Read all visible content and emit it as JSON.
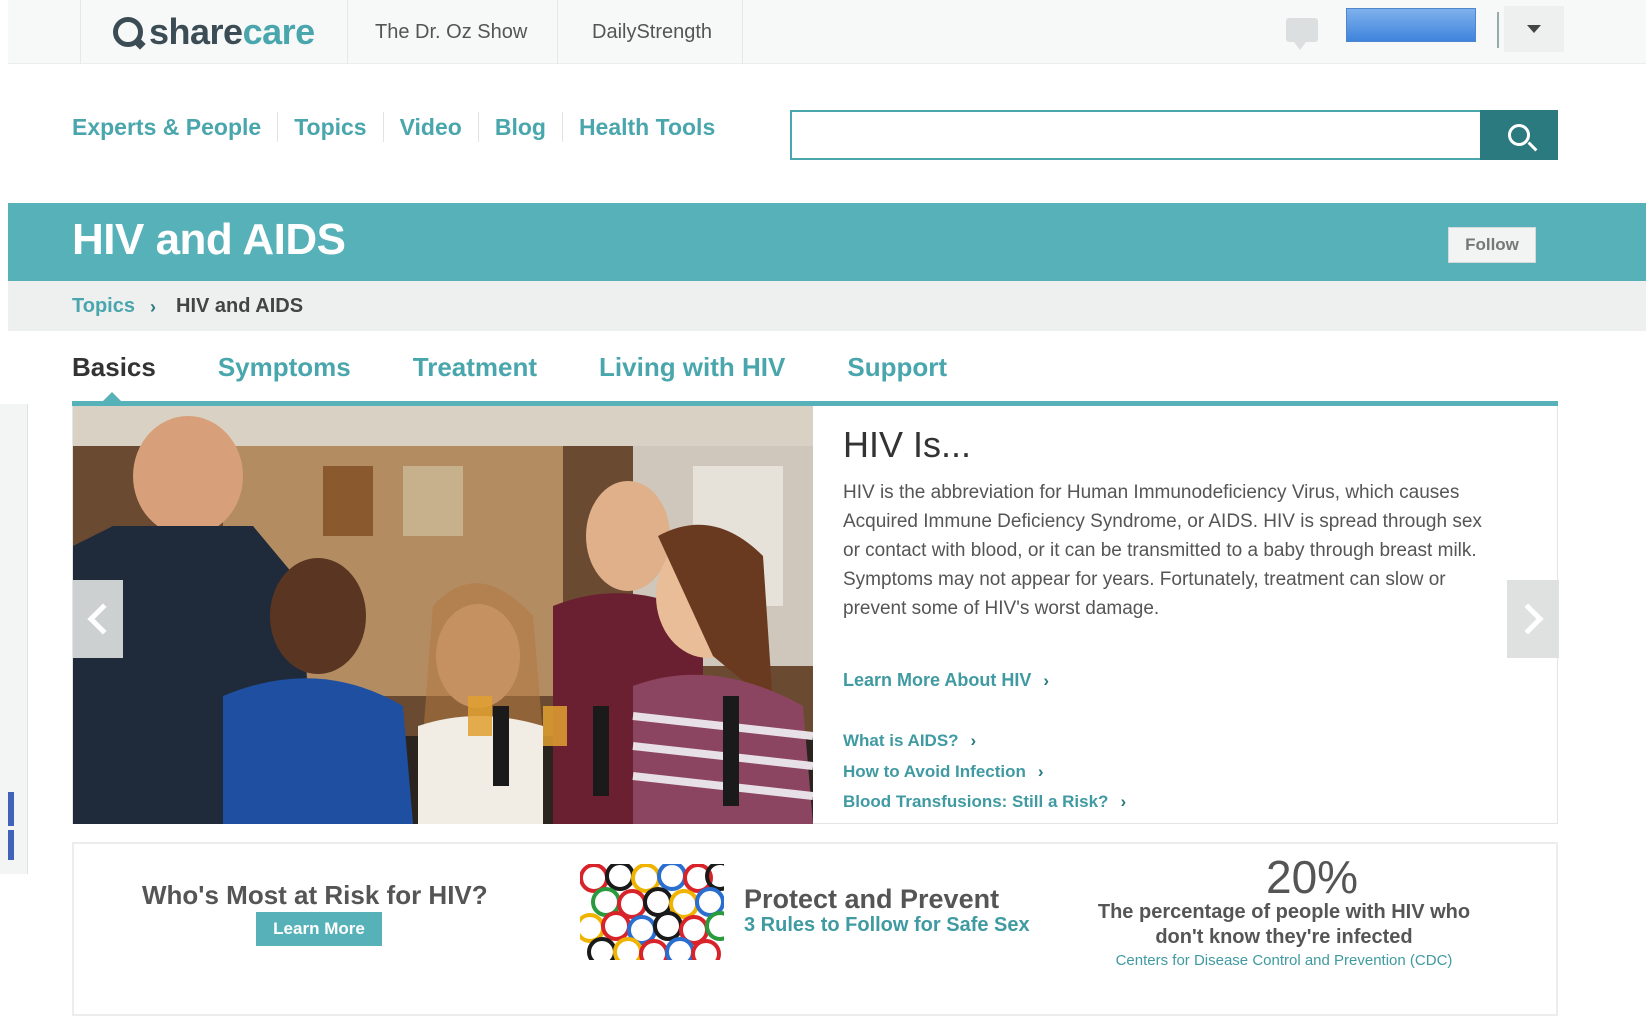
{
  "topbar": {
    "logo_part1": "share",
    "logo_part2": "care",
    "links": [
      "The Dr. Oz Show",
      "DailyStrength"
    ]
  },
  "nav": {
    "items": [
      "Experts & People",
      "Topics",
      "Video",
      "Blog",
      "Health Tools"
    ],
    "search_placeholder": ""
  },
  "banner": {
    "title": "HIV and AIDS",
    "follow_label": "Follow"
  },
  "breadcrumb": {
    "parent": "Topics",
    "separator": "›",
    "current": "HIV and AIDS"
  },
  "tabs": {
    "items": [
      "Basics",
      "Symptoms",
      "Treatment",
      "Living with HIV",
      "Support"
    ],
    "active": "Basics"
  },
  "hero": {
    "title": "HIV Is...",
    "body": "HIV is the abbreviation for Human Immunodeficiency Virus, which causes Acquired Immune Deficiency Syndrome, or AIDS. HIV is spread through sex or contact with blood, or it can be transmitted to a baby through breast milk. Symptoms may not appear for years. Fortunately, treatment can slow or prevent some of HIV's worst damage.",
    "learn_more": "Learn More About HIV",
    "links": [
      "What is AIDS?",
      "How to Avoid Infection",
      "Blood Transfusions: Still a Risk?"
    ],
    "chevron": "›"
  },
  "promo": {
    "risk_title": "Who's Most at Risk for HIV?",
    "risk_button": "Learn More",
    "protect_title": "Protect and Prevent",
    "protect_subtitle": "3 Rules to Follow for Safe Sex",
    "stat_value": "20%",
    "stat_text": "The percentage of people with HIV who don't know they're infected",
    "stat_source": "Centers for Disease Control and Prevention (CDC)"
  },
  "colors": {
    "teal": "#57b1b8",
    "teal_dark": "#2b7a80",
    "link": "#4aa6ad"
  }
}
